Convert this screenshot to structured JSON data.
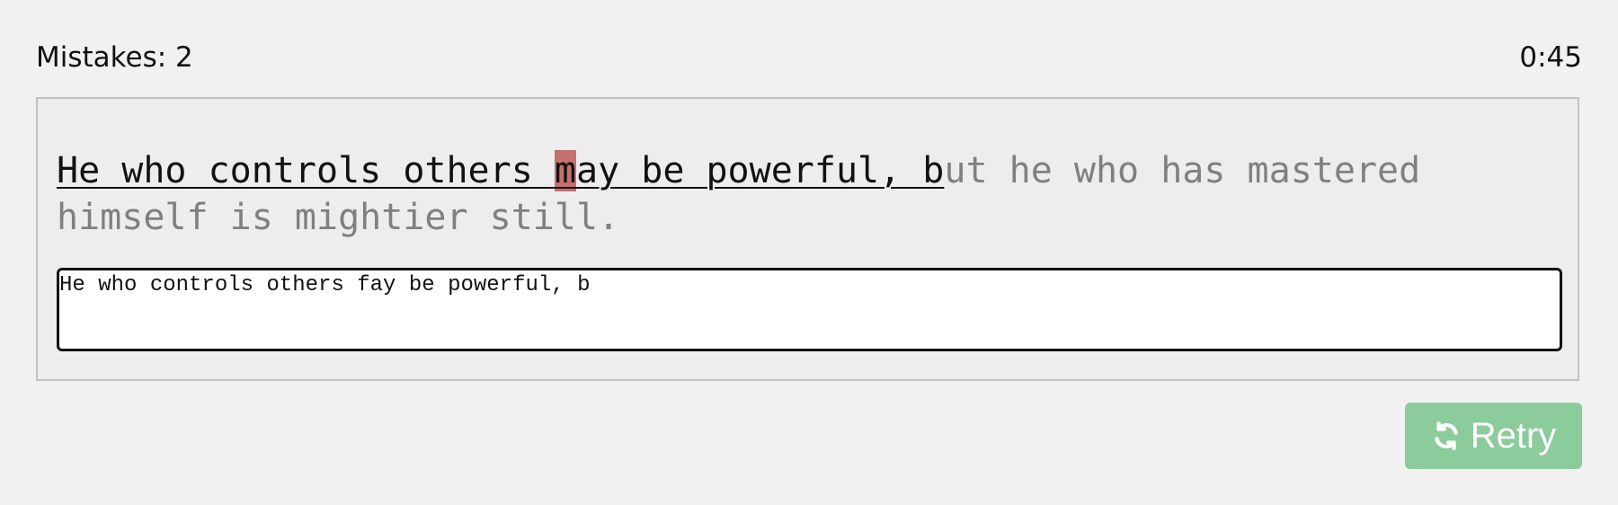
{
  "stats": {
    "mistakes_label": "Mistakes: 2",
    "timer": "0:45"
  },
  "quote": {
    "typed_before": "He who controls others ",
    "error_char": "m",
    "typed_after": "ay be powerful, b",
    "remaining": "ut he who has mastered himself is mightier still."
  },
  "input": {
    "value": "He who controls others fay be powerful, b"
  },
  "retry": {
    "label": "Retry",
    "icon": "refresh-icon"
  },
  "colors": {
    "error_highlight": "#c4706f",
    "retry_button": "#8ccb9b",
    "pending_text": "#808080"
  }
}
